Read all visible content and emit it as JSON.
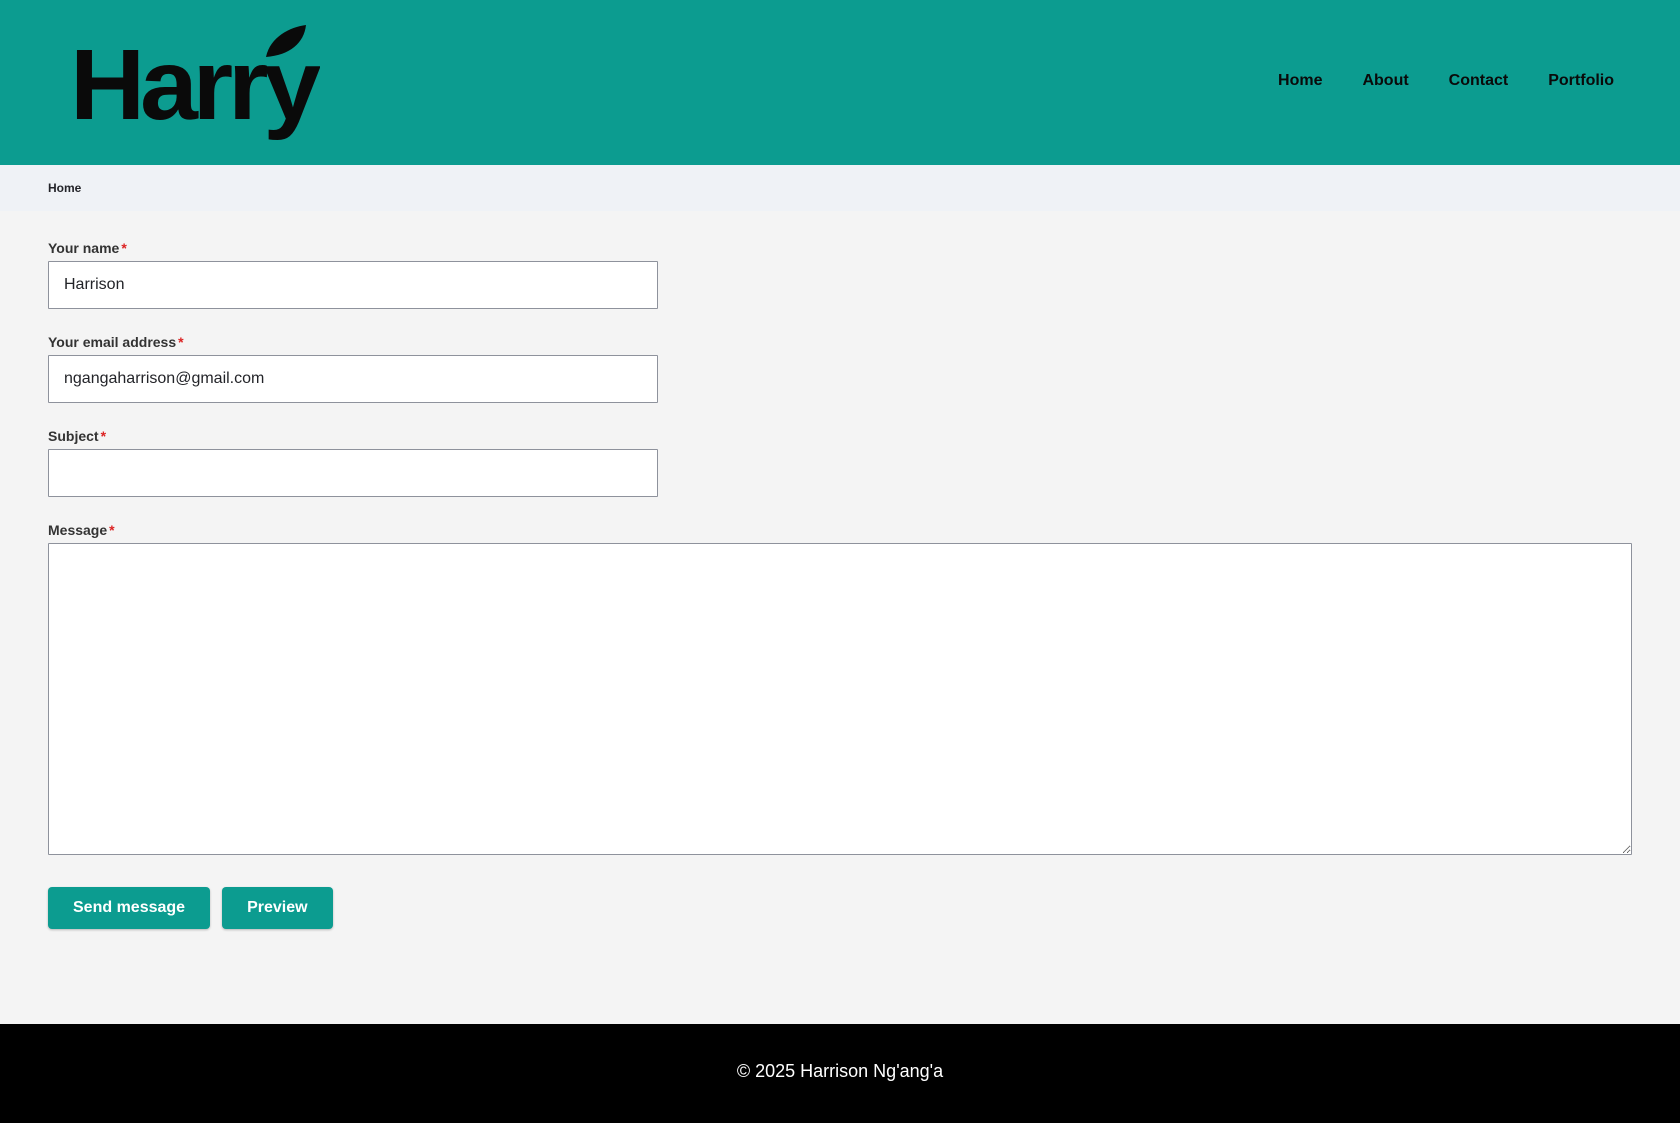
{
  "site": {
    "logo_text": "Harry",
    "brand_color": "#0c9c90"
  },
  "nav": {
    "items": [
      {
        "label": "Home"
      },
      {
        "label": "About"
      },
      {
        "label": "Contact"
      },
      {
        "label": "Portfolio"
      }
    ]
  },
  "breadcrumb": {
    "home_label": "Home"
  },
  "form": {
    "name": {
      "label": "Your name",
      "required_mark": "*",
      "value": "Harrison"
    },
    "email": {
      "label": "Your email address",
      "required_mark": "*",
      "value": "ngangaharrison@gmail.com"
    },
    "subject": {
      "label": "Subject",
      "required_mark": "*",
      "value": ""
    },
    "message": {
      "label": "Message",
      "required_mark": "*",
      "value": ""
    },
    "send_label": "Send message",
    "preview_label": "Preview"
  },
  "footer": {
    "copyright": "© 2025 Harrison Ng'ang'a"
  }
}
